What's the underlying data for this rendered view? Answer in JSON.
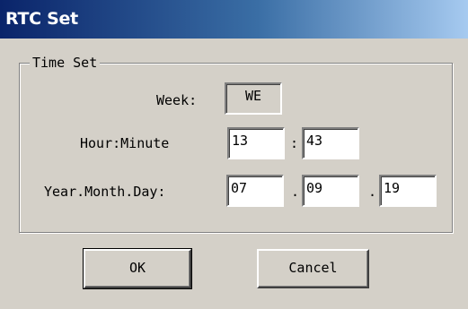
{
  "window": {
    "title": "RTC Set"
  },
  "group": {
    "label": "Time Set"
  },
  "week": {
    "label": "Week:",
    "value": "WE"
  },
  "hour_minute": {
    "label": "Hour:Minute",
    "hour": "13",
    "separator": ":",
    "minute": "43"
  },
  "date": {
    "label": "Year.Month.Day:",
    "year": "07",
    "sep1": ".",
    "month": "09",
    "sep2": ".",
    "day": "19"
  },
  "buttons": {
    "ok": "OK",
    "cancel": "Cancel"
  }
}
